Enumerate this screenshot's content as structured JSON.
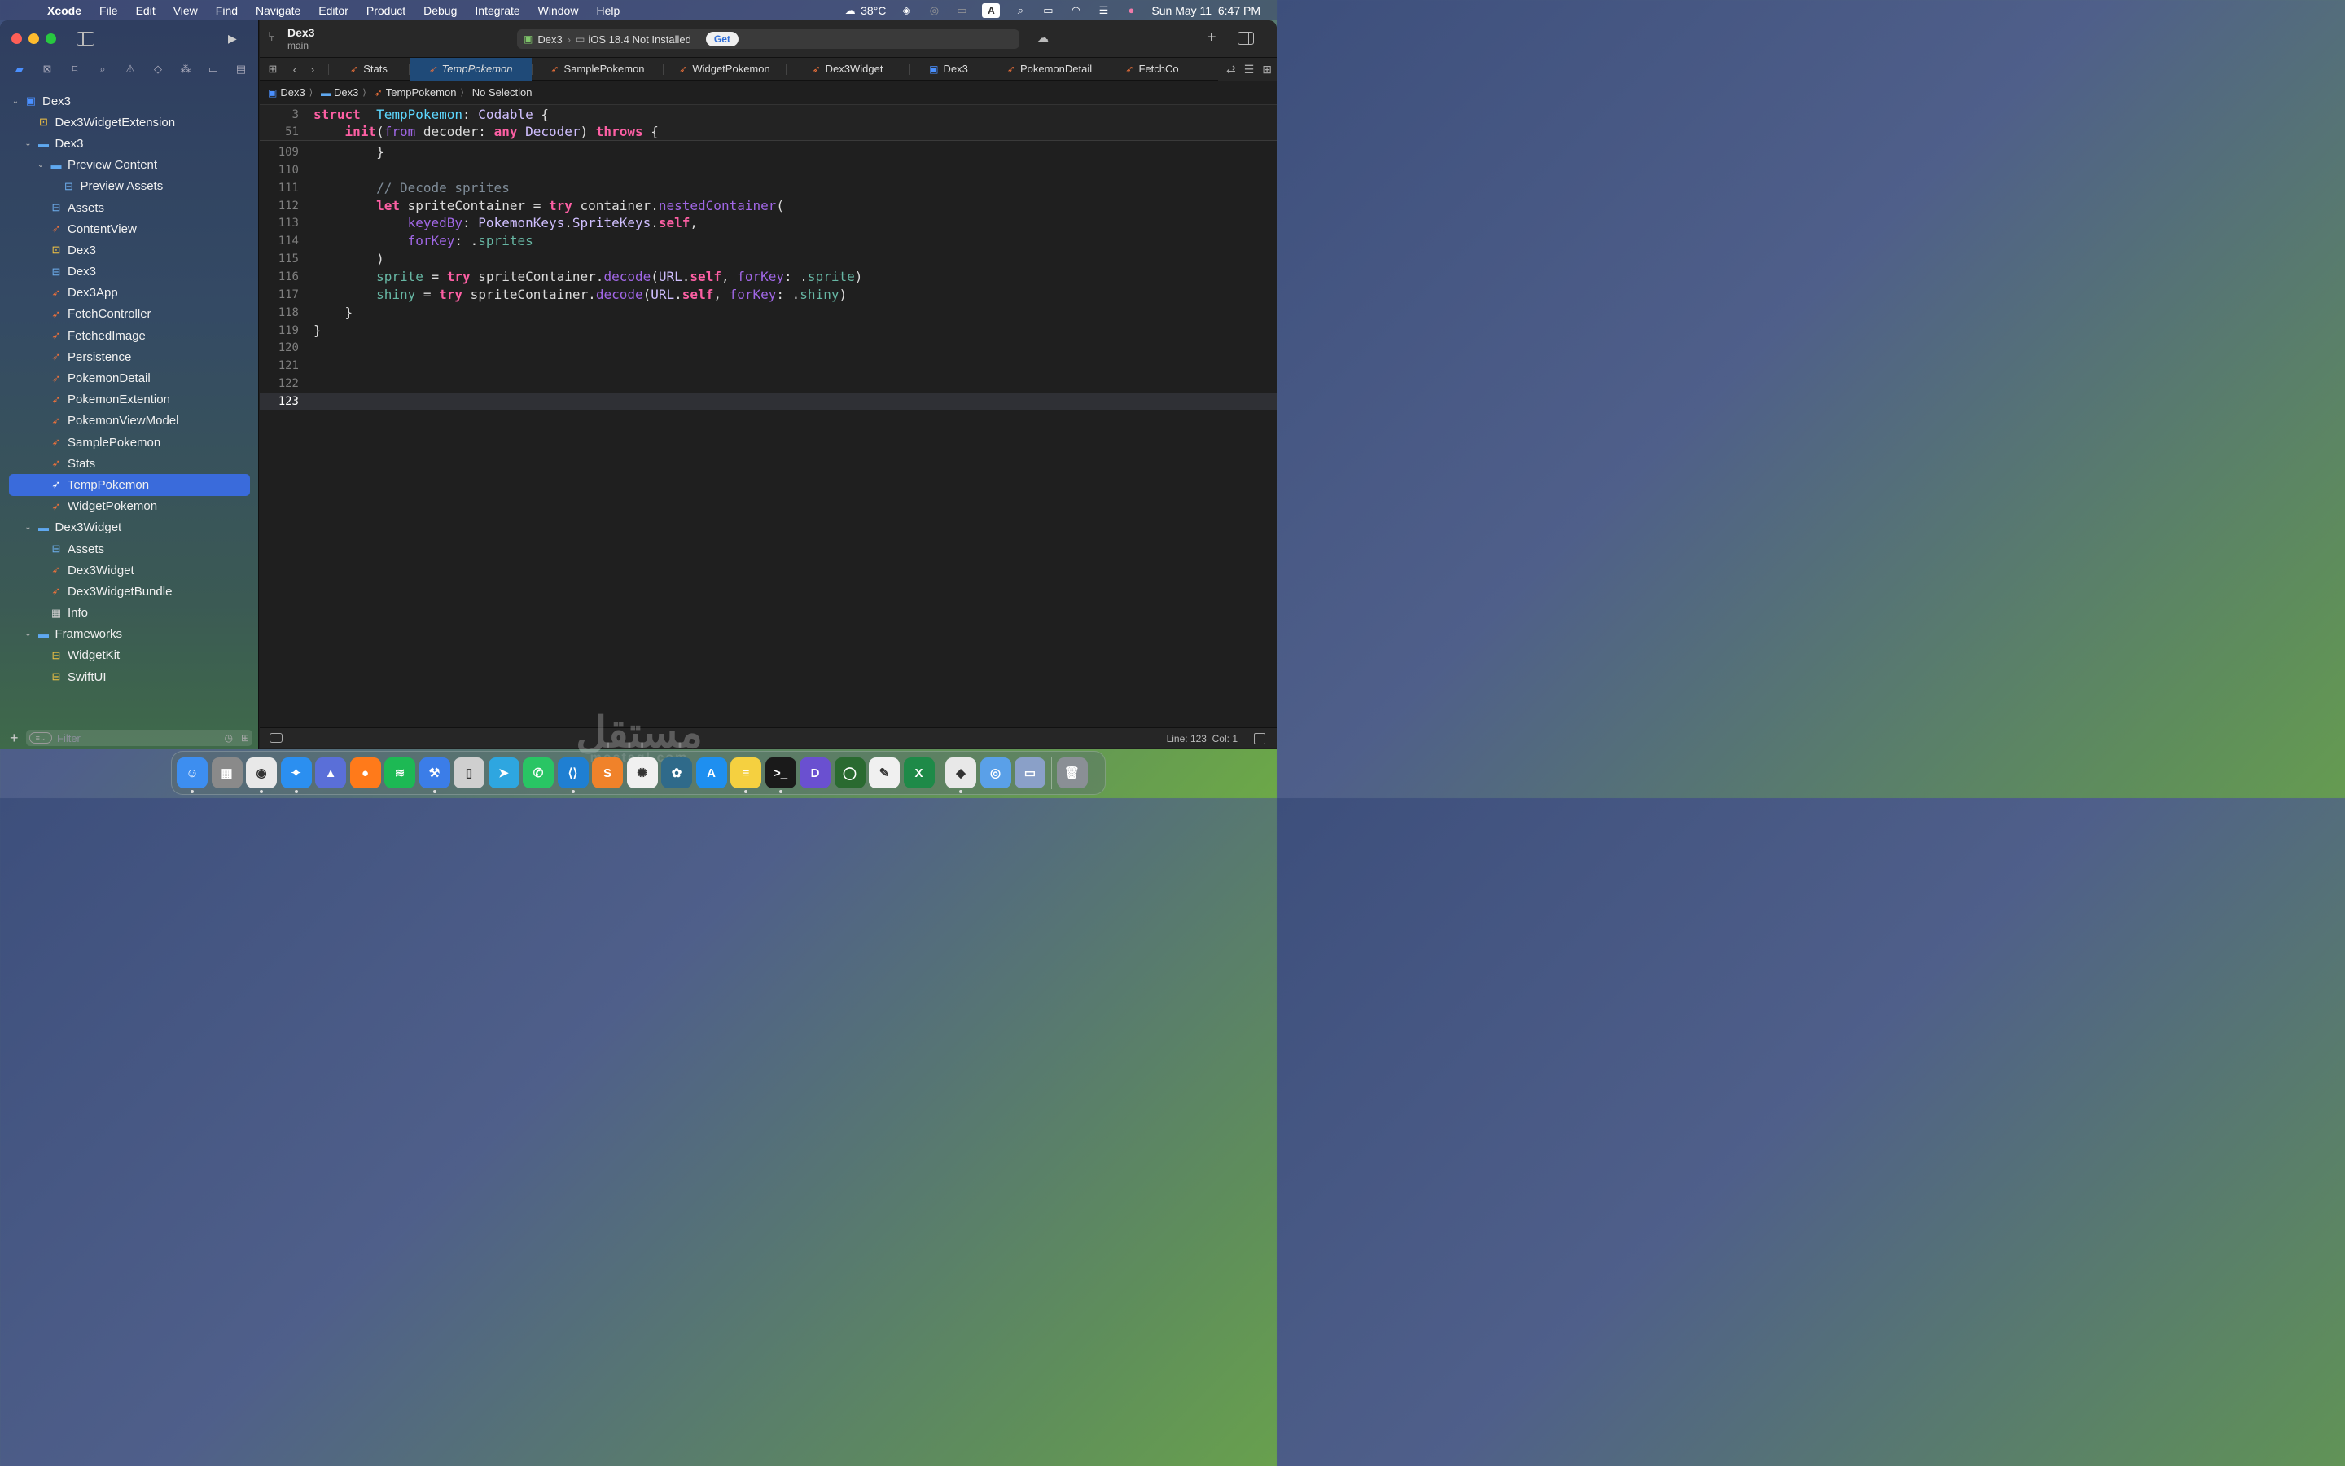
{
  "menubar": {
    "app": "Xcode",
    "items": [
      "File",
      "Edit",
      "View",
      "Find",
      "Navigate",
      "Editor",
      "Product",
      "Debug",
      "Integrate",
      "Window",
      "Help"
    ],
    "weather": "38°C",
    "datetime": "Sun May 11  6:47 PM",
    "input_source": "A"
  },
  "toolbar": {
    "project": "Dex3",
    "branch": "main",
    "scheme": "Dex3",
    "destination": "iOS 18.4 Not Installed",
    "get_label": "Get"
  },
  "tabs": [
    {
      "label": "Stats",
      "active": false
    },
    {
      "label": "TempPokemon",
      "active": true
    },
    {
      "label": "SamplePokemon",
      "active": false
    },
    {
      "label": "WidgetPokemon",
      "active": false
    },
    {
      "label": "Dex3Widget",
      "active": false
    },
    {
      "label": "Dex3",
      "active": false
    },
    {
      "label": "PokemonDetail",
      "active": false
    },
    {
      "label": "FetchCo",
      "active": false
    }
  ],
  "jumpbar": {
    "items": [
      "Dex3",
      "Dex3",
      "TempPokemon",
      "No Selection"
    ]
  },
  "tree": [
    {
      "label": "Dex3",
      "depth": 0,
      "icon": "project",
      "chevron": "open"
    },
    {
      "label": "Dex3WidgetExtension",
      "depth": 1,
      "icon": "target",
      "chevron": ""
    },
    {
      "label": "Dex3",
      "depth": 1,
      "icon": "folder",
      "chevron": "open"
    },
    {
      "label": "Preview Content",
      "depth": 2,
      "icon": "folder",
      "chevron": "open"
    },
    {
      "label": "Preview Assets",
      "depth": 3,
      "icon": "assets",
      "chevron": ""
    },
    {
      "label": "Assets",
      "depth": 2,
      "icon": "assets",
      "chevron": ""
    },
    {
      "label": "ContentView",
      "depth": 2,
      "icon": "swift",
      "chevron": ""
    },
    {
      "label": "Dex3",
      "depth": 2,
      "icon": "target",
      "chevron": ""
    },
    {
      "label": "Dex3",
      "depth": 2,
      "icon": "assets",
      "chevron": ""
    },
    {
      "label": "Dex3App",
      "depth": 2,
      "icon": "swift",
      "chevron": ""
    },
    {
      "label": "FetchController",
      "depth": 2,
      "icon": "swift",
      "chevron": ""
    },
    {
      "label": "FetchedImage",
      "depth": 2,
      "icon": "swift",
      "chevron": ""
    },
    {
      "label": "Persistence",
      "depth": 2,
      "icon": "swift",
      "chevron": ""
    },
    {
      "label": "PokemonDetail",
      "depth": 2,
      "icon": "swift",
      "chevron": ""
    },
    {
      "label": "PokemonExtention",
      "depth": 2,
      "icon": "swift",
      "chevron": ""
    },
    {
      "label": "PokemonViewModel",
      "depth": 2,
      "icon": "swift",
      "chevron": ""
    },
    {
      "label": "SamplePokemon",
      "depth": 2,
      "icon": "swift",
      "chevron": ""
    },
    {
      "label": "Stats",
      "depth": 2,
      "icon": "swift",
      "chevron": ""
    },
    {
      "label": "TempPokemon",
      "depth": 2,
      "icon": "swift",
      "chevron": "",
      "selected": true
    },
    {
      "label": "WidgetPokemon",
      "depth": 2,
      "icon": "swift",
      "chevron": ""
    },
    {
      "label": "Dex3Widget",
      "depth": 1,
      "icon": "folder",
      "chevron": "open"
    },
    {
      "label": "Assets",
      "depth": 2,
      "icon": "assets",
      "chevron": ""
    },
    {
      "label": "Dex3Widget",
      "depth": 2,
      "icon": "swift",
      "chevron": ""
    },
    {
      "label": "Dex3WidgetBundle",
      "depth": 2,
      "icon": "swift",
      "chevron": ""
    },
    {
      "label": "Info",
      "depth": 2,
      "icon": "plist",
      "chevron": ""
    },
    {
      "label": "Frameworks",
      "depth": 1,
      "icon": "folder",
      "chevron": "open"
    },
    {
      "label": "WidgetKit",
      "depth": 2,
      "icon": "framework",
      "chevron": ""
    },
    {
      "label": "SwiftUI",
      "depth": 2,
      "icon": "framework",
      "chevron": ""
    }
  ],
  "filter": {
    "placeholder": "Filter"
  },
  "sticky_lines": [
    {
      "num": "3",
      "tokens": [
        [
          "kw",
          "struct"
        ],
        [
          "",
          "  "
        ],
        [
          "ty",
          "TempPokemon"
        ],
        [
          "",
          ": "
        ],
        [
          "ty2",
          "Codable"
        ],
        [
          "",
          " {"
        ]
      ]
    },
    {
      "num": "51",
      "tokens": [
        [
          "",
          "    "
        ],
        [
          "kw",
          "init"
        ],
        [
          "",
          "("
        ],
        [
          "lbl",
          "from"
        ],
        [
          "",
          " decoder: "
        ],
        [
          "kw",
          "any"
        ],
        [
          "",
          ""
        ],
        [
          "ty2",
          " Decoder"
        ],
        [
          "",
          ") "
        ],
        [
          "kw",
          "throws"
        ],
        [
          "",
          " {"
        ]
      ]
    }
  ],
  "code_lines": [
    {
      "num": "109",
      "tokens": [
        [
          "",
          "        }"
        ]
      ]
    },
    {
      "num": "110",
      "tokens": []
    },
    {
      "num": "111",
      "tokens": [
        [
          "",
          "        "
        ],
        [
          "cm",
          "// Decode sprites"
        ]
      ]
    },
    {
      "num": "112",
      "tokens": [
        [
          "",
          "        "
        ],
        [
          "kw",
          "let"
        ],
        [
          "",
          " spriteContainer = "
        ],
        [
          "kw",
          "try"
        ],
        [
          "",
          " container."
        ],
        [
          "fn",
          "nestedContainer"
        ],
        [
          "",
          "("
        ]
      ]
    },
    {
      "num": "113",
      "tokens": [
        [
          "",
          "            "
        ],
        [
          "lbl",
          "keyedBy"
        ],
        [
          "",
          ": "
        ],
        [
          "ty2",
          "PokemonKeys"
        ],
        [
          "",
          "."
        ],
        [
          "ty2",
          "SpriteKeys"
        ],
        [
          "",
          "."
        ],
        [
          "kw",
          "self"
        ],
        [
          "",
          ","
        ]
      ]
    },
    {
      "num": "114",
      "tokens": [
        [
          "",
          "            "
        ],
        [
          "lbl",
          "forKey"
        ],
        [
          "",
          ": ."
        ],
        [
          "prop",
          "sprites"
        ]
      ]
    },
    {
      "num": "115",
      "tokens": [
        [
          "",
          "        )"
        ]
      ]
    },
    {
      "num": "116",
      "tokens": [
        [
          "",
          "        "
        ],
        [
          "prop",
          "sprite"
        ],
        [
          "",
          " = "
        ],
        [
          "kw",
          "try"
        ],
        [
          "",
          " spriteContainer."
        ],
        [
          "fn",
          "decode"
        ],
        [
          "",
          "("
        ],
        [
          "ty2",
          "URL"
        ],
        [
          "",
          "."
        ],
        [
          "kw",
          "self"
        ],
        [
          "",
          ", "
        ],
        [
          "lbl",
          "forKey"
        ],
        [
          "",
          ": ."
        ],
        [
          "prop",
          "sprite"
        ],
        [
          "",
          ")"
        ]
      ]
    },
    {
      "num": "117",
      "tokens": [
        [
          "",
          "        "
        ],
        [
          "prop",
          "shiny"
        ],
        [
          "",
          " = "
        ],
        [
          "kw",
          "try"
        ],
        [
          "",
          " spriteContainer."
        ],
        [
          "fn",
          "decode"
        ],
        [
          "",
          "("
        ],
        [
          "ty2",
          "URL"
        ],
        [
          "",
          "."
        ],
        [
          "kw",
          "self"
        ],
        [
          "",
          ", "
        ],
        [
          "lbl",
          "forKey"
        ],
        [
          "",
          ": ."
        ],
        [
          "prop",
          "shiny"
        ],
        [
          "",
          ")"
        ]
      ]
    },
    {
      "num": "118",
      "tokens": [
        [
          "",
          "    }"
        ]
      ]
    },
    {
      "num": "119",
      "tokens": [
        [
          "",
          "}"
        ]
      ]
    },
    {
      "num": "120",
      "tokens": []
    },
    {
      "num": "121",
      "tokens": []
    },
    {
      "num": "122",
      "tokens": []
    },
    {
      "num": "123",
      "tokens": [],
      "current": true
    }
  ],
  "status": {
    "position": "Line: 123  Col: 1"
  },
  "watermark": {
    "main": "مستقل",
    "sub": "mostaql.com"
  },
  "dock": [
    {
      "name": "finder",
      "color": "#3d8ef0",
      "glyph": "☺",
      "running": true
    },
    {
      "name": "launchpad",
      "color": "#8a8a8a",
      "glyph": "▦",
      "running": false
    },
    {
      "name": "chrome",
      "color": "#e8e8e8",
      "glyph": "◉",
      "running": true
    },
    {
      "name": "safari",
      "color": "#2b8ff0",
      "glyph": "✦",
      "running": true
    },
    {
      "name": "affinity",
      "color": "#5a6fd8",
      "glyph": "▲",
      "running": false
    },
    {
      "name": "firefox",
      "color": "#ff7a1a",
      "glyph": "●",
      "running": false
    },
    {
      "name": "spotify",
      "color": "#1db954",
      "glyph": "≋",
      "running": false
    },
    {
      "name": "xcode",
      "color": "#3b7de8",
      "glyph": "⚒",
      "running": true
    },
    {
      "name": "sim",
      "color": "#cfcfcf",
      "glyph": "▯",
      "running": false
    },
    {
      "name": "telegram",
      "color": "#2ea6e0",
      "glyph": "➤",
      "running": false
    },
    {
      "name": "whatsapp",
      "color": "#29c564",
      "glyph": "✆",
      "running": false
    },
    {
      "name": "vscode",
      "color": "#1f7fd2",
      "glyph": "⟨⟩",
      "running": true
    },
    {
      "name": "sublime",
      "color": "#f0822a",
      "glyph": "S",
      "running": false
    },
    {
      "name": "chatgpt",
      "color": "#f0f0f0",
      "glyph": "✺",
      "running": false
    },
    {
      "name": "devapp",
      "color": "#2f6a8a",
      "glyph": "✿",
      "running": false
    },
    {
      "name": "appstore",
      "color": "#1e8ff0",
      "glyph": "A",
      "running": false
    },
    {
      "name": "notes",
      "color": "#f5d040",
      "glyph": "≡",
      "running": true
    },
    {
      "name": "terminal",
      "color": "#1a1a1a",
      "glyph": ">_",
      "running": true
    },
    {
      "name": "d-app",
      "color": "#6a50d0",
      "glyph": "D",
      "running": false
    },
    {
      "name": "ring-app",
      "color": "#2a6a30",
      "glyph": "◯",
      "running": false
    },
    {
      "name": "textedit",
      "color": "#f0f0f0",
      "glyph": "✎",
      "running": false
    },
    {
      "name": "excel",
      "color": "#1e8a48",
      "glyph": "X",
      "running": false
    },
    {
      "name": "sep",
      "color": "",
      "glyph": "",
      "running": false
    },
    {
      "name": "cube-app",
      "color": "#e8e8e8",
      "glyph": "◆",
      "running": true
    },
    {
      "name": "preview",
      "color": "#5aa0e8",
      "glyph": "◎",
      "running": false
    },
    {
      "name": "screenshot",
      "color": "#8aa0c8",
      "glyph": "▭",
      "running": false
    },
    {
      "name": "sep",
      "color": "",
      "glyph": "",
      "running": false
    },
    {
      "name": "trash",
      "color": "#8a8f95",
      "glyph": "🗑",
      "running": false
    }
  ]
}
